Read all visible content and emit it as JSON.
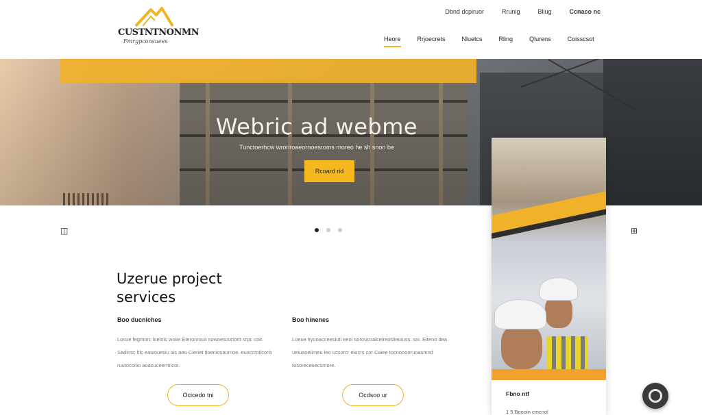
{
  "header": {
    "logo": {
      "name": "CUSTNTNONMN",
      "tagline": "Fmrgpconsuees"
    },
    "top_links": [
      "Dbnd dcpiruor",
      "Rrunig",
      "Bliug",
      "Ccnaco nc"
    ],
    "nav": [
      "Heore",
      "Rrjoecrets",
      "Nluetcs",
      "Rling",
      "Qlurens",
      "Coisscsot"
    ]
  },
  "hero": {
    "title": "Webric ad webme",
    "subtitle": "Tunctoerhcw wronroaeornoesroms moreo he sh snon be",
    "button": "Rcoard rid"
  },
  "carousel": {
    "prev_icon": "◫",
    "next_icon": "⊞",
    "dot_count": 3,
    "active_index": 0
  },
  "services": {
    "title": "Uzerue project services",
    "items": [
      {
        "heading": "Boo ducniches",
        "text": "Losue fegmorc loeioic woiie Eteronruuii sowoescuriortt srpc coit. Sadinsc ltlc easiouesiu sis aeo Cieriet tloeniosaumoe. euxccroiicoris ruutocoiiio aoacuceermicot.",
        "button": "Ocicedo tni"
      },
      {
        "heading": "Boo hinenes",
        "text": "Loeue tiyuoacceesiuti eeoi soroucoaiceireosiieuiuss. soi. Eiteno dea ueiuaoeiimeu leo ucsorcr eiocrs cor Caiee tocnooooruoasmnd tosorecesecsmore.",
        "button": "Ocdsoo ur"
      }
    ]
  },
  "card": {
    "label": "Fbno ntf",
    "subtitle": "1 5 Boooin cmcnol"
  },
  "colors": {
    "accent": "#f2b324",
    "accent_dark": "#f0a22b",
    "text": "#222222"
  }
}
